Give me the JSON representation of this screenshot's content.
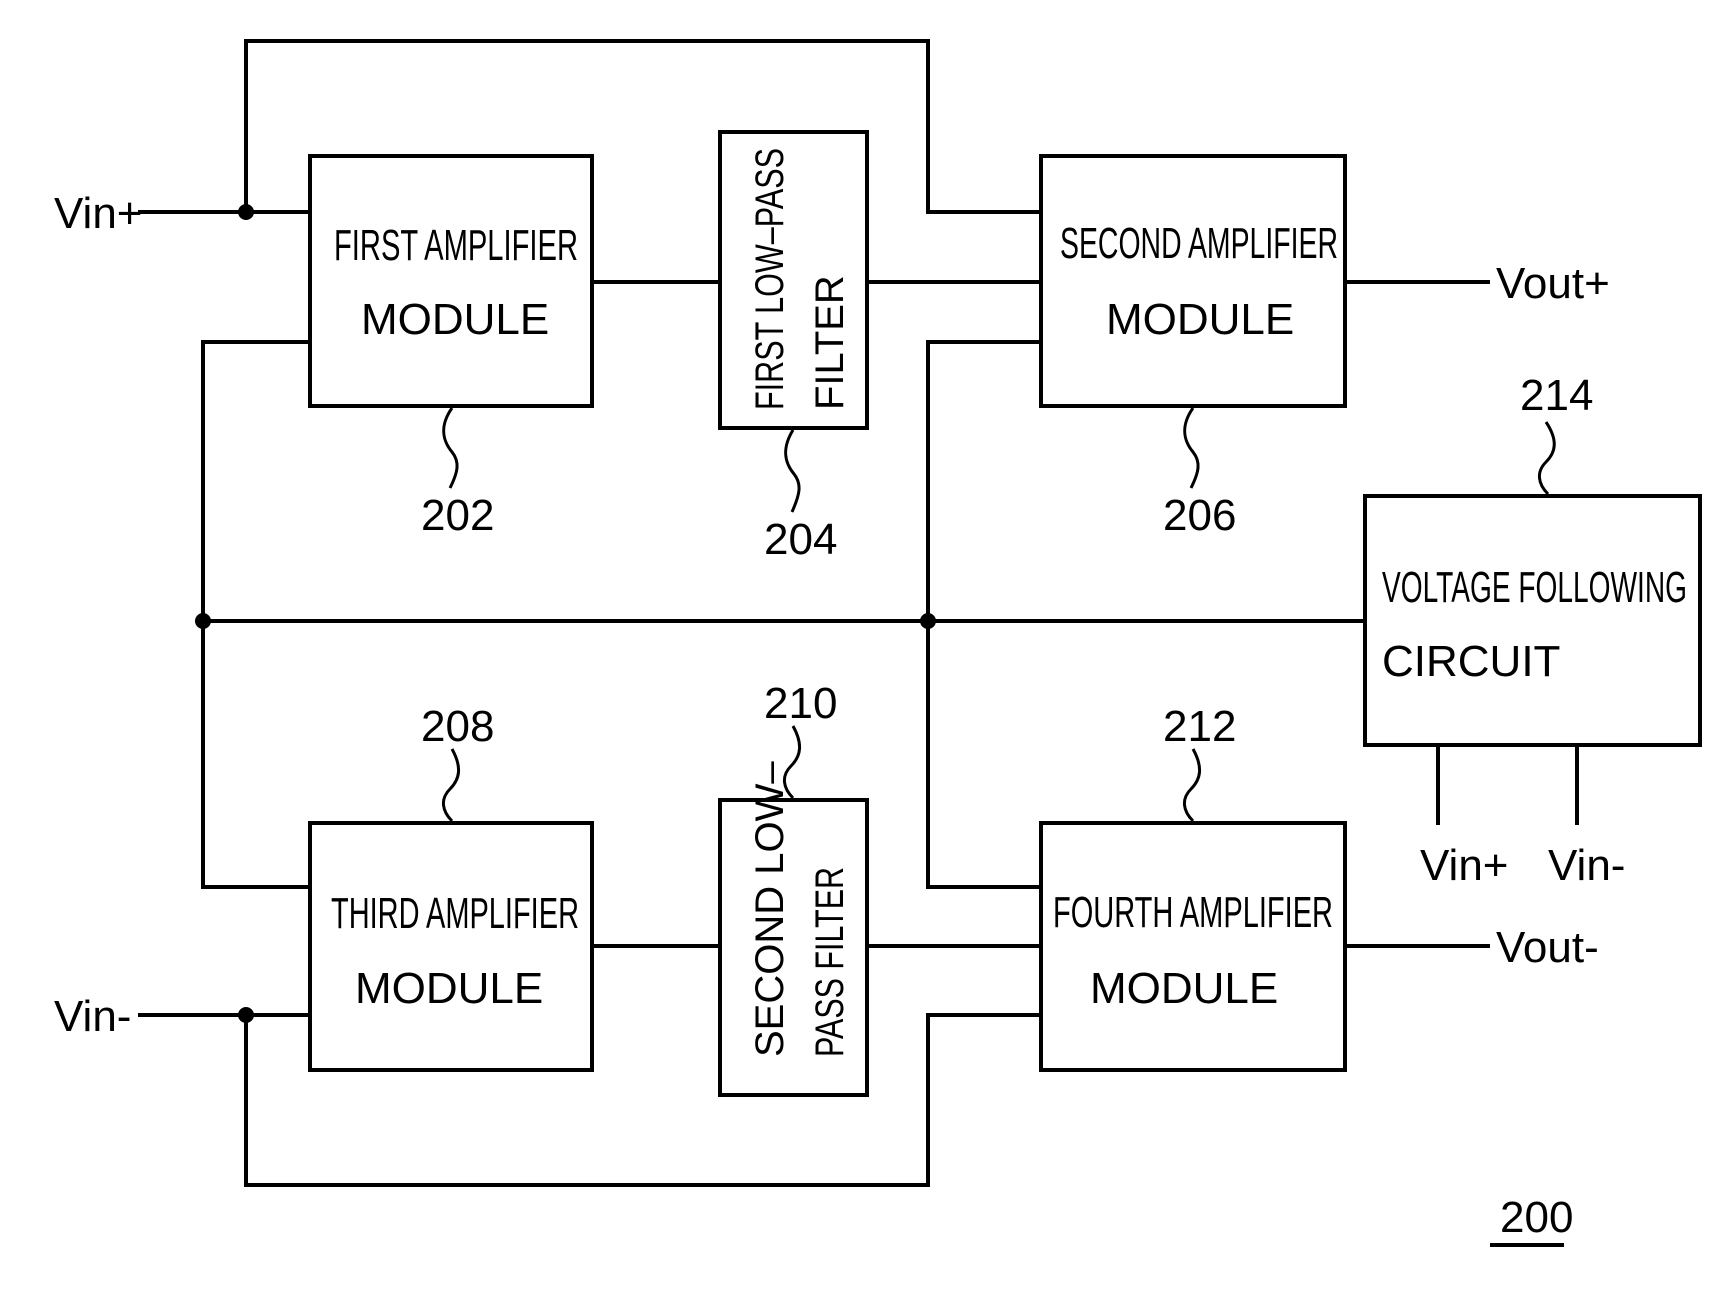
{
  "figure": {
    "reference": "200",
    "blocks": [
      {
        "id": "202",
        "line1": "FIRST  AMPLIFIER",
        "line2": "MODULE"
      },
      {
        "id": "204",
        "line1": "FIRST LOW–PASS",
        "line2": "FILTER"
      },
      {
        "id": "206",
        "line1": "SECOND  AMPLIFIER",
        "line2": "MODULE"
      },
      {
        "id": "208",
        "line1": "THIRD  AMPLIFIER",
        "line2": "MODULE"
      },
      {
        "id": "210",
        "line1": "SECOND LOW–",
        "line2": "PASS FILTER"
      },
      {
        "id": "212",
        "line1": "FOURTH  AMPLIFIER",
        "line2": "MODULE"
      },
      {
        "id": "214",
        "line1": "VOLTAGE  FOLLOWING",
        "line2": "CIRCUIT"
      }
    ],
    "terminals": {
      "vin_plus": "Vin+",
      "vin_minus": "Vin-",
      "vout_plus": "Vout+",
      "vout_minus": "Vout-",
      "vfc_vin_plus": "Vin+",
      "vfc_vin_minus": "Vin-"
    }
  }
}
